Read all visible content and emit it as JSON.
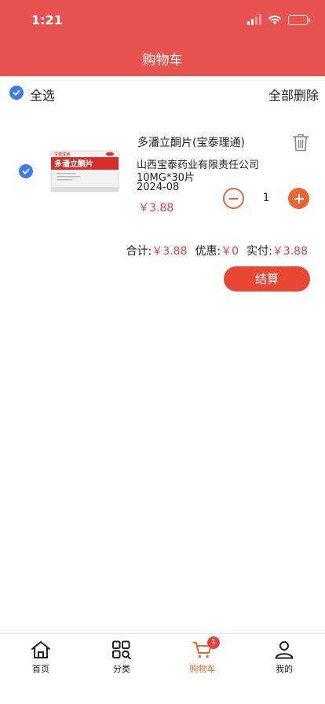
{
  "status_bar": {
    "time": "1:21"
  },
  "header": {
    "title": "购物车"
  },
  "toolbar": {
    "select_all_label": "全选",
    "delete_all_label": "全部删除"
  },
  "cart_item": {
    "image_title": "多潘立酮片",
    "image_brand": "宝泰理通",
    "name": "多潘立酮片(宝泰理通)",
    "manufacturer": "山西宝泰药业有限责任公司",
    "spec": "10MG*30片",
    "date": "2024-08",
    "price": "￥3.88",
    "quantity": "1"
  },
  "summary": {
    "total_label": "合计:",
    "total_value": "￥3.88",
    "discount_label": "优惠:",
    "discount_value": "￥0",
    "paid_label": "实付:",
    "paid_value": "￥3.88",
    "checkout_label": "结算"
  },
  "tabbar": {
    "home": "首页",
    "category": "分类",
    "cart": "购物车",
    "cart_badge": "1",
    "mine": "我的"
  },
  "colors": {
    "header": "#e85350",
    "accent": "#ec6632",
    "price": "#e64340",
    "checkbox": "#3a7ee6"
  }
}
